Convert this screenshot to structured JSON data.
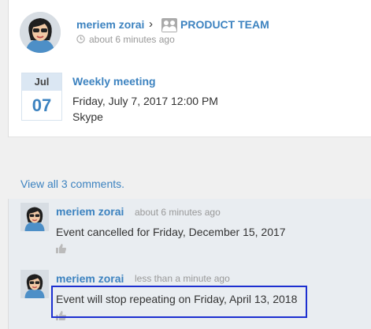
{
  "post": {
    "author": "meriem zorai",
    "separator": "›",
    "team": "PRODUCT TEAM",
    "time": "about 6 minutes ago"
  },
  "event": {
    "month": "Jul",
    "day": "07",
    "title": "Weekly meeting",
    "datetime": "Friday, July 7, 2017 12:00 PM",
    "location": "Skype"
  },
  "view_all": "View all 3 comments.",
  "comments": [
    {
      "author": "meriem zorai",
      "time": "about 6 minutes ago",
      "text": "Event cancelled for Friday, December 15, 2017"
    },
    {
      "author": "meriem zorai",
      "time": "less than a minute ago",
      "text": "Event will stop repeating on Friday, April 13, 2018"
    }
  ],
  "colors": {
    "link": "#3d83c0",
    "highlight": "#1c2fd0"
  }
}
